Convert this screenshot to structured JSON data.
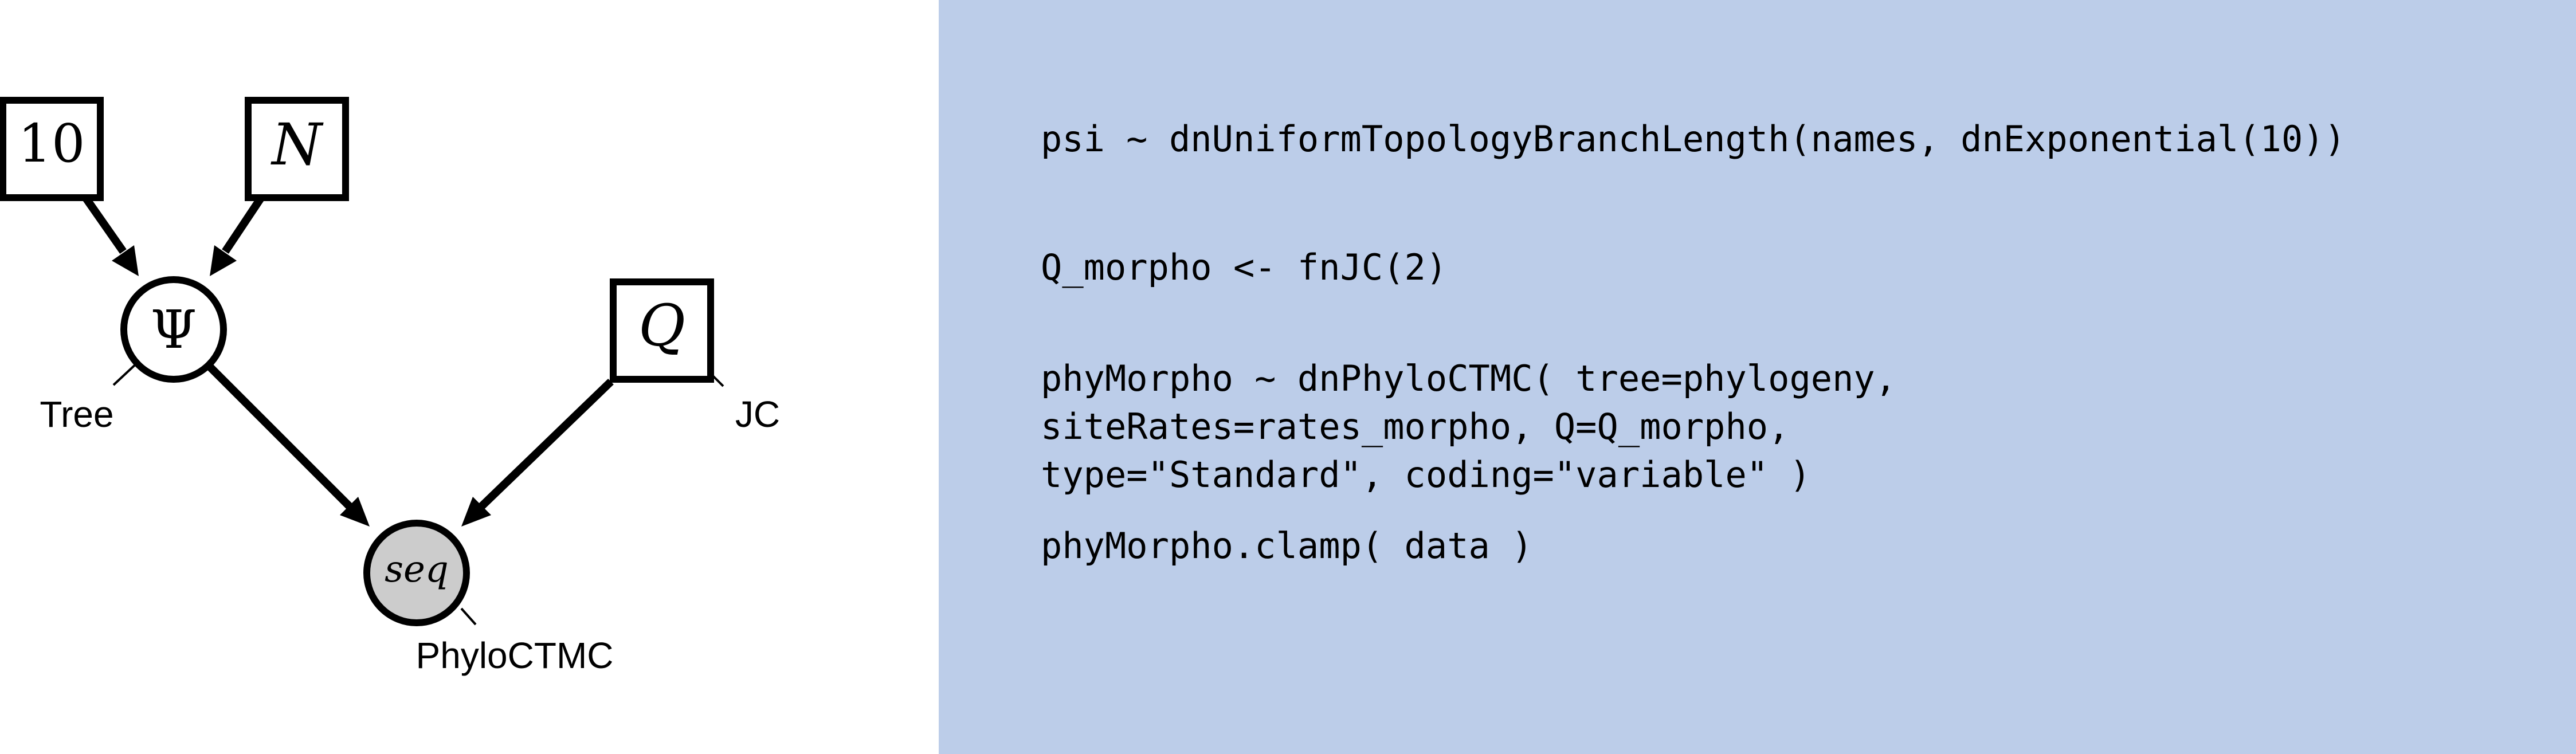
{
  "diagram": {
    "nodes": {
      "ten": {
        "label": "10",
        "kind": "constant"
      },
      "n": {
        "label": "N",
        "kind": "constant"
      },
      "psi": {
        "label": "Ψ",
        "kind": "stochastic",
        "annotation": "Tree"
      },
      "q": {
        "label": "Q",
        "kind": "constant",
        "annotation": "JC"
      },
      "seq": {
        "label": "seq",
        "kind": "observed",
        "annotation": "PhyloCTMC"
      }
    },
    "edges": [
      {
        "from": "10",
        "to": "Ψ"
      },
      {
        "from": "N",
        "to": "Ψ"
      },
      {
        "from": "Ψ",
        "to": "seq"
      },
      {
        "from": "Q",
        "to": "seq"
      }
    ],
    "colors": {
      "observed_fill": "#cccccc",
      "node_stroke": "#000000"
    }
  },
  "code": {
    "panel_color": "#bccde9",
    "lines": [
      "psi ∼ dnUniformTopologyBranchLength(names, dnExponential(10))",
      "Q_morpho <- fnJC(2)",
      "phyMorpho ∼ dnPhyloCTMC( tree=phylogeny,",
      "siteRates=rates_morpho, Q=Q_morpho,",
      "type=\"Standard\", coding=\"variable\" )",
      "phyMorpho.clamp( data )"
    ]
  }
}
